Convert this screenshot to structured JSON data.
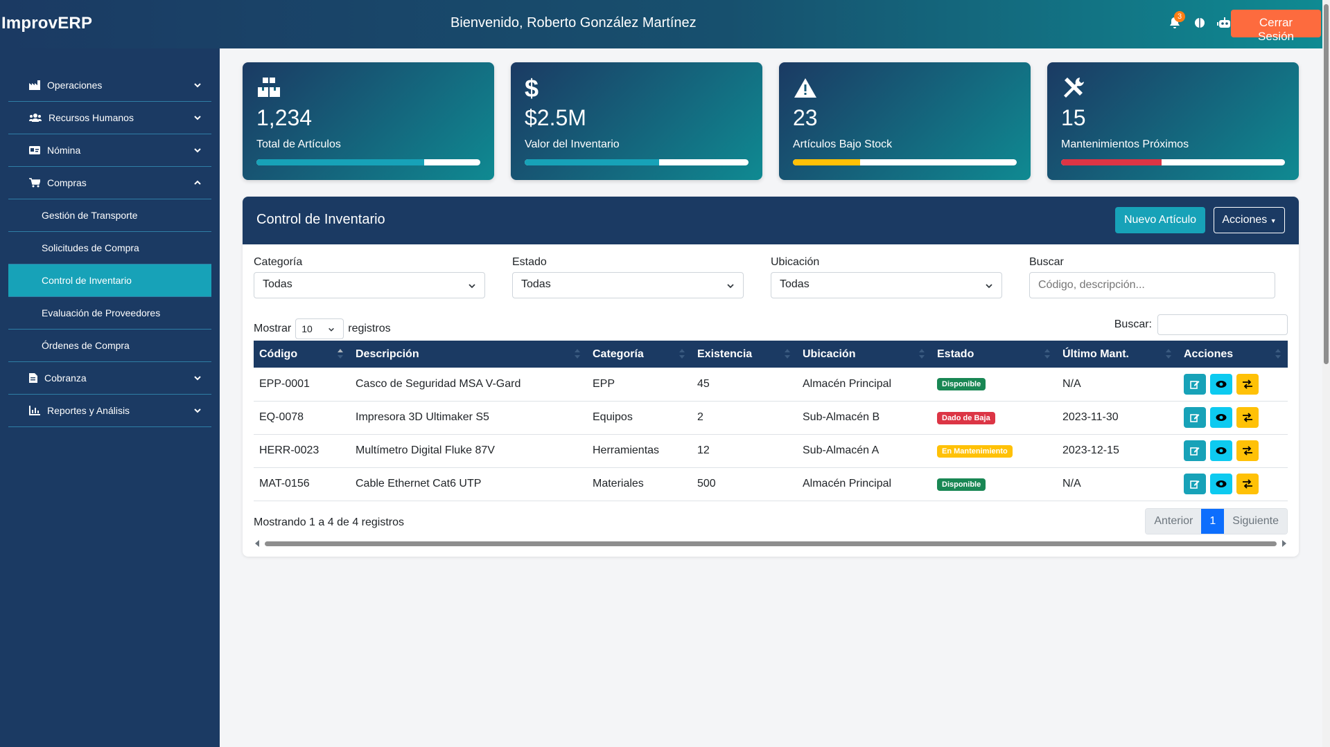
{
  "header": {
    "brand": "ImprovERP",
    "welcome": "Bienvenido, Roberto González Martínez",
    "notifications_count": "3",
    "logout_label": "Cerrar Sesión"
  },
  "sidebar": {
    "items": [
      {
        "label": "Operaciones",
        "icon": "factory-icon"
      },
      {
        "label": "Recursos Humanos",
        "icon": "users-icon"
      },
      {
        "label": "Nómina",
        "icon": "id-card-icon"
      },
      {
        "label": "Compras",
        "icon": "cart-icon"
      },
      {
        "label": "Gestión de Transporte"
      },
      {
        "label": "Solicitudes de Compra"
      },
      {
        "label": "Control de Inventario"
      },
      {
        "label": "Evaluación de Proveedores"
      },
      {
        "label": "Órdenes de Compra"
      },
      {
        "label": "Cobranza",
        "icon": "invoice-icon"
      },
      {
        "label": "Reportes y Análisis",
        "icon": "chart-icon"
      }
    ]
  },
  "stats": [
    {
      "value": "1,234",
      "label": "Total de Artículos",
      "icon": "boxes-icon",
      "progress": 0.75,
      "color": "#17a2b8"
    },
    {
      "value": "$2.5M",
      "label": "Valor del Inventario",
      "icon": "dollar-icon",
      "progress": 0.6,
      "color": "#17a2b8"
    },
    {
      "value": "23",
      "label": "Artículos Bajo Stock",
      "icon": "warning-icon",
      "progress": 0.3,
      "color": "#ffc107"
    },
    {
      "value": "15",
      "label": "Mantenimientos Próximos",
      "icon": "tools-icon",
      "progress": 0.45,
      "color": "#dc3545"
    }
  ],
  "panel": {
    "title": "Control de Inventario",
    "new_label": "Nuevo Artículo",
    "actions_label": "Acciones"
  },
  "filters": {
    "category_label": "Categoría",
    "category_value": "Todas",
    "status_label": "Estado",
    "status_value": "Todas",
    "location_label": "Ubicación",
    "location_value": "Todas",
    "search_label": "Buscar",
    "search_placeholder": "Código, descripción..."
  },
  "table_controls": {
    "show_label": "Mostrar",
    "page_size": "10",
    "records_label": "registros",
    "search_label": "Buscar:"
  },
  "table": {
    "columns": [
      "Código",
      "Descripción",
      "Categoría",
      "Existencia",
      "Ubicación",
      "Estado",
      "Último Mant.",
      "Acciones"
    ],
    "rows": [
      {
        "code": "EPP-0001",
        "desc": "Casco de Seguridad MSA V-Gard",
        "cat": "EPP",
        "qty": "45",
        "loc": "Almacén Principal",
        "status": "Disponible",
        "status_color": "#198754",
        "last": "N/A"
      },
      {
        "code": "EQ-0078",
        "desc": "Impresora 3D Ultimaker S5",
        "cat": "Equipos",
        "qty": "2",
        "loc": "Sub-Almacén B",
        "status": "Dado de Baja",
        "status_color": "#dc3545",
        "last": "2023-11-30"
      },
      {
        "code": "HERR-0023",
        "desc": "Multímetro Digital Fluke 87V",
        "cat": "Herramientas",
        "qty": "12",
        "loc": "Sub-Almacén A",
        "status": "En Mantenimiento",
        "status_color": "#ffc107",
        "last": "2023-12-15"
      },
      {
        "code": "MAT-0156",
        "desc": "Cable Ethernet Cat6 UTP",
        "cat": "Materiales",
        "qty": "500",
        "loc": "Almacén Principal",
        "status": "Disponible",
        "status_color": "#198754",
        "last": "N/A"
      }
    ]
  },
  "footer": {
    "info": "Mostrando 1 a 4 de 4 registros",
    "prev": "Anterior",
    "page": "1",
    "next": "Siguiente"
  }
}
